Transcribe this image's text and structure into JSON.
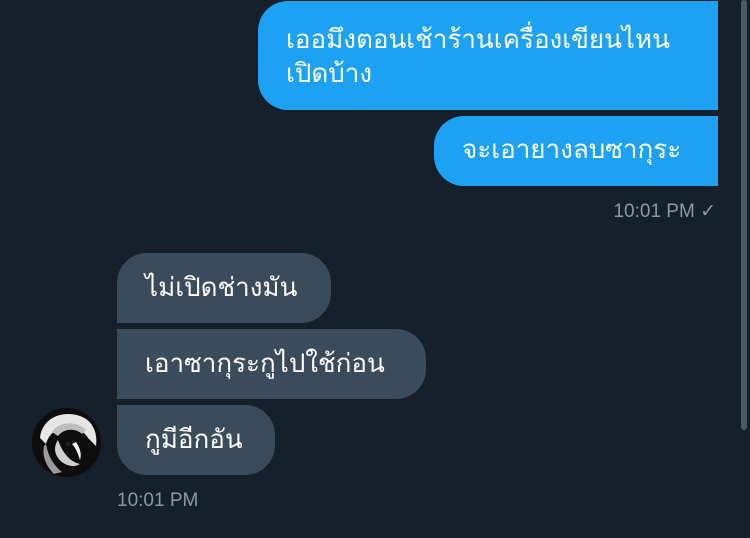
{
  "messages": {
    "sent": [
      {
        "text": "เออมึงตอนเช้าร้านเครื่องเขียนไหนเปิดบ้าง"
      },
      {
        "text": "จะเอายางลบซากุระ"
      }
    ],
    "sent_meta": {
      "time": "10:01 PM",
      "status_icon": "✓"
    },
    "received": [
      {
        "text": "ไม่เปิดช่างมัน"
      },
      {
        "text": "เอาซากุระกูไปใช้ก่อน"
      },
      {
        "text": "กูมีอีกอัน"
      }
    ],
    "received_meta": {
      "time": "10:01 PM"
    }
  },
  "icons": {
    "read_receipt": "check-icon",
    "avatar": "user-avatar"
  },
  "colors": {
    "background": "#15202b",
    "sent_bubble": "#1da1f2",
    "received_bubble": "#3a4b5c",
    "meta_text": "#8899a6"
  }
}
